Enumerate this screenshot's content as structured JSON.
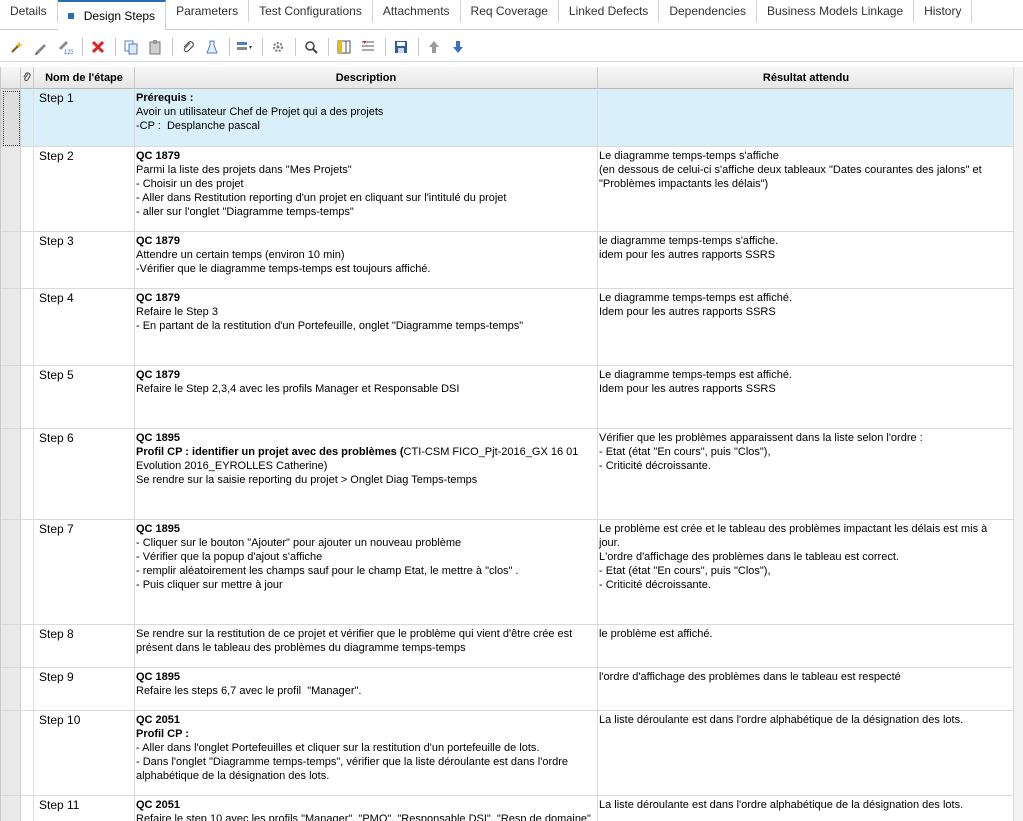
{
  "tabs": [
    {
      "label": "Details"
    },
    {
      "label": "Design Steps"
    },
    {
      "label": "Parameters"
    },
    {
      "label": "Test Configurations"
    },
    {
      "label": "Attachments"
    },
    {
      "label": "Req Coverage"
    },
    {
      "label": "Linked Defects"
    },
    {
      "label": "Dependencies"
    },
    {
      "label": "Business Models Linkage"
    },
    {
      "label": "History"
    }
  ],
  "toolbar_icons": [
    "new-step-icon",
    "edit-step-icon",
    "renumber-steps-icon",
    "delete-icon",
    "copy-icon",
    "paste-icon",
    "attachment-icon",
    "call-to-test-icon",
    "generate-script-icon",
    "parameters-icon",
    "find-icon",
    "select-columns-icon",
    "grid-filter-icon",
    "save-icon",
    "move-up-icon",
    "move-down-icon"
  ],
  "columns": {
    "attachment": "📎",
    "name": "Nom de l'étape",
    "description": "Description",
    "expected": "Résultat attendu"
  },
  "steps": [
    {
      "name": "Step 1",
      "description": [
        {
          "text": "Prérequis :",
          "bold": true
        },
        {
          "text": "Avoir un utilisateur Chef de Projet qui a des projets"
        },
        {
          "text": "-CP :  Desplanche pascal"
        }
      ],
      "expected": []
    },
    {
      "name": "Step 2",
      "description": [
        {
          "text": "QC 1879",
          "bold": true
        },
        {
          "text": "Parmi la liste des projets dans \"Mes Projets\""
        },
        {
          "text": "- Choisir un des projet"
        },
        {
          "text": "- Aller dans Restitution reporting d'un projet en cliquant sur l'intitulé du projet"
        },
        {
          "text": "- aller sur l'onglet \"Diagramme temps-temps\""
        }
      ],
      "expected": [
        {
          "text": "Le diagramme temps-temps s'affiche"
        },
        {
          "text": "(en dessous de celui-ci s'affiche deux tableaux \"Dates courantes des jalons\" et \"Problèmes impactants les délais\")"
        }
      ]
    },
    {
      "name": "Step 3",
      "description": [
        {
          "text": "QC 1879",
          "bold": true
        },
        {
          "text": "Attendre un certain temps (environ 10 min)"
        },
        {
          "text": "-Vérifier que le diagramme temps-temps est toujours affiché."
        }
      ],
      "expected": [
        {
          "text": "le diagramme temps-temps s'affiche."
        },
        {
          "text": "idem pour les autres rapports SSRS"
        }
      ]
    },
    {
      "name": "Step 4",
      "description": [
        {
          "text": "QC 1879",
          "bold": true
        },
        {
          "text": "Refaire le Step 3"
        },
        {
          "text": "- En partant de la restitution d'un Portefeuille, onglet \"Diagramme temps-temps\""
        }
      ],
      "expected": [
        {
          "text": "Le diagramme temps-temps est affiché."
        },
        {
          "text": "Idem pour les autres rapports SSRS"
        }
      ]
    },
    {
      "name": "Step 5",
      "description": [
        {
          "text": "QC 1879",
          "bold": true
        },
        {
          "text": "Refaire le Step 2,3,4 avec les profils Manager et Responsable DSI"
        }
      ],
      "expected": [
        {
          "text": "Le diagramme temps-temps est affiché."
        },
        {
          "text": "Idem pour les autres rapports SSRS"
        }
      ]
    },
    {
      "name": "Step 6",
      "description": [
        {
          "text": "QC 1895",
          "bold": true
        },
        {
          "text": "Profil CP : identifier un projet avec des problèmes (",
          "bold": true,
          "rest": "CTI-CSM FICO_Pjt-2016_GX 16 01 Evolution 2016_EYROLLES Catherine)"
        },
        {
          "text": "Se rendre sur la saisie reporting du projet > Onglet Diag Temps-temps"
        }
      ],
      "expected": [
        {
          "text": "Vérifier que les problèmes apparaissent dans la liste selon l'ordre :"
        },
        {
          "text": "- Etat (état \"En cours\", puis \"Clos\"),"
        },
        {
          "text": "- Criticité décroissante."
        }
      ]
    },
    {
      "name": "Step 7",
      "description": [
        {
          "text": "QC 1895",
          "bold": true
        },
        {
          "text": "- Cliquer sur le bouton \"Ajouter\" pour ajouter un nouveau problème"
        },
        {
          "text": "- Vérifier que la popup d'ajout s'affiche"
        },
        {
          "text": "- remplir aléatoirement les champs sauf pour le champ Etat, le mettre à \"clos\" ."
        },
        {
          "text": "- Puis cliquer sur mettre à jour"
        }
      ],
      "expected": [
        {
          "text": "Le problème est crée et le tableau des problèmes impactant les délais est mis à jour."
        },
        {
          "text": "L'ordre d'affichage des problèmes dans le tableau est correct."
        },
        {
          "text": "- Etat (état \"En cours\", puis \"Clos\"),"
        },
        {
          "text": "- Criticité décroissante."
        }
      ]
    },
    {
      "name": "Step 8",
      "description": [
        {
          "text": "Se rendre sur la restitution de ce projet et vérifier que le problème qui vient d'être crée est présent dans le tableau des problèmes du diagramme temps-temps"
        }
      ],
      "expected": [
        {
          "text": "le problème est affiché."
        }
      ]
    },
    {
      "name": "Step 9",
      "description": [
        {
          "text": "QC 1895",
          "bold": true
        },
        {
          "text": "Refaire les steps 6,7 avec le profil  \"Manager\"."
        }
      ],
      "expected": [
        {
          "text": "l'ordre d'affichage des problèmes dans le tableau est respecté"
        }
      ]
    },
    {
      "name": "Step 10",
      "description": [
        {
          "text": "QC 2051",
          "bold": true
        },
        {
          "text": "Profil CP :",
          "bold": true
        },
        {
          "text": "- Aller dans l'onglet Portefeuilles et cliquer sur la restitution d'un portefeuille de lots."
        },
        {
          "text": "- Dans l'onglet \"Diagramme temps-temps\", vérifier que la liste déroulante est dans l'ordre alphabétique de la désignation des lots."
        }
      ],
      "expected": [
        {
          "text": "La liste déroulante est dans l'ordre alphabétique de la désignation des lots."
        }
      ]
    },
    {
      "name": "Step 11",
      "description": [
        {
          "text": "QC 2051",
          "bold": true
        },
        {
          "text": "Refaire le step 10 avec les profils \"Manager\", \"PMO\", \"Responsable DSI\", \"Resp de domaine\""
        }
      ],
      "expected": [
        {
          "text": "La liste déroulante est dans l'ordre alphabétique de la désignation des lots."
        }
      ]
    }
  ]
}
